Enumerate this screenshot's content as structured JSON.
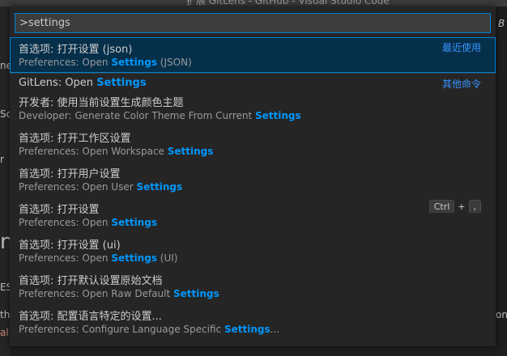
{
  "window": {
    "title": "扩展 GitLens - GitHub - Visual Studio Code"
  },
  "background_fragments": {
    "left_1": "ne",
    "left_2": "Sc",
    "left_3": "r",
    "left_4": "n",
    "left_5": "ES",
    "left_6": "th",
    "left_7": "al",
    "right_1": "B",
    "right_2": "on."
  },
  "quick_pick": {
    "input_value": ">settings",
    "items": [
      {
        "label_pre": "首选项: 打开设置 (json)",
        "label_hl": "",
        "label_post": "",
        "detail_pre": "Preferences: Open ",
        "detail_hl": "Settings",
        "detail_post": " (JSON)",
        "group": "最近使用"
      },
      {
        "label_pre": "GitLens: Open ",
        "label_hl": "Settings",
        "label_post": "",
        "group": "其他命令"
      },
      {
        "label_pre": "开发者: 使用当前设置生成颜色主题",
        "label_hl": "",
        "label_post": "",
        "detail_pre": "Developer: Generate Color Theme From Current ",
        "detail_hl": "Settings",
        "detail_post": ""
      },
      {
        "label_pre": "首选项: 打开工作区设置",
        "label_hl": "",
        "label_post": "",
        "detail_pre": "Preferences: Open Workspace ",
        "detail_hl": "Settings",
        "detail_post": ""
      },
      {
        "label_pre": "首选项: 打开用户设置",
        "label_hl": "",
        "label_post": "",
        "detail_pre": "Preferences: Open User ",
        "detail_hl": "Settings",
        "detail_post": ""
      },
      {
        "label_pre": "首选项: 打开设置",
        "label_hl": "",
        "label_post": "",
        "detail_pre": "Preferences: Open ",
        "detail_hl": "Settings",
        "detail_post": "",
        "keys": [
          "Ctrl",
          "+",
          ","
        ]
      },
      {
        "label_pre": "首选项: 打开设置 (ui)",
        "label_hl": "",
        "label_post": "",
        "detail_pre": "Preferences: Open ",
        "detail_hl": "Settings",
        "detail_post": " (UI)"
      },
      {
        "label_pre": "首选项: 打开默认设置原始文档",
        "label_hl": "",
        "label_post": "",
        "detail_pre": "Preferences: Open Raw Default ",
        "detail_hl": "Settings",
        "detail_post": ""
      },
      {
        "label_pre": "首选项: 配置语言特定的设置...",
        "label_hl": "",
        "label_post": "",
        "detail_pre": "Preferences: Configure Language Specific ",
        "detail_hl": "Settings",
        "detail_post": "..."
      }
    ]
  },
  "colors": {
    "accent": "#007fd4",
    "highlight": "#0097fb",
    "group_label": "#3794ff",
    "active_bg": "#062f4a"
  }
}
